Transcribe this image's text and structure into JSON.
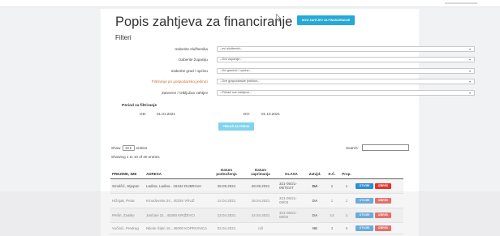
{
  "header": {
    "title": "Popis zahtjeva za financiranje",
    "new_button": "NOVI ZAHTJEV ZA FINANCIRANJE"
  },
  "filters": {
    "heading": "Filteri",
    "rows": [
      {
        "label": "Izaberite službenika",
        "value": "--svi službenici--",
        "accent": false
      },
      {
        "label": "Izaberite županiju",
        "value": "--Sve županije--",
        "accent": false
      },
      {
        "label": "Izaberite grad / općinu",
        "value": "--Svi gradovi / općine--",
        "accent": false
      },
      {
        "label": "Filtriranje po gospodarskoj jedinici",
        "value": "--Sve gospodarske jedinice--",
        "accent": true
      },
      {
        "label": "Zatvoren / Otključan zahtjev",
        "value": "--Prikaži sve zahtjeve--",
        "accent": false
      }
    ],
    "period_title": "Period za filtriranje",
    "from_label": "OD:",
    "from_value": "01.01.2021",
    "to_label": "DO:",
    "to_value": "01.10.2021",
    "search_button": "PRIKAŽI ZA PERIOD"
  },
  "table_controls": {
    "show_prefix": "Show",
    "show_value": "10",
    "show_suffix": "entries",
    "search_label": "Search:",
    "info": "Showing 1 to 10 of 20 entries"
  },
  "table": {
    "headers": [
      "PREZIME, IME",
      "ADRESA",
      "Datum podnošenja",
      "Datum zaprimanja",
      "KLASA",
      "Zatvjd.",
      "K.Č.",
      "Prop."
    ],
    "open_label": "OTVORI",
    "delete_label": "IZBRIŠI",
    "rows": [
      {
        "name": "Smolčić, Stjepan",
        "address": "Ladina, Ladina . 16342 DUBRAVA",
        "submitted": "28.09.2021",
        "received": "28.09.2021",
        "klasa": "321-05/21-09/TEST",
        "closed": "DA",
        "kc": "1",
        "prop": "1"
      },
      {
        "name": "Hižnjak, Petar",
        "address": "Kmodovska 24 , 40326 VRUŽ",
        "submitted": "14.04.2021",
        "received": "16.04.2021",
        "klasa": "321-05/21-09/03",
        "closed": "DA",
        "kc": "1",
        "prop": "1"
      },
      {
        "name": "Perlin, Zvatko",
        "address": "Jančani 31 , 40260 KRIŽEVCI",
        "submitted": "13.04.2021",
        "received": "14.04.2021",
        "klasa": "321-05/21-09/02",
        "closed": "DA",
        "kc": "14",
        "prop": "1"
      },
      {
        "name": "Vučinić, Predrag",
        "address": "Nikole Šipki 16 , 46000 KOPRIVNICA",
        "submitted": "02.04.2021",
        "received": "n/il",
        "klasa": "",
        "closed": "NE",
        "kc": "3",
        "prop": "0"
      }
    ]
  },
  "colors": {
    "primary": "#27a9d6",
    "open_button": "#2c8ed4",
    "delete_button": "#e2342c",
    "accent_label": "#c9742e"
  }
}
